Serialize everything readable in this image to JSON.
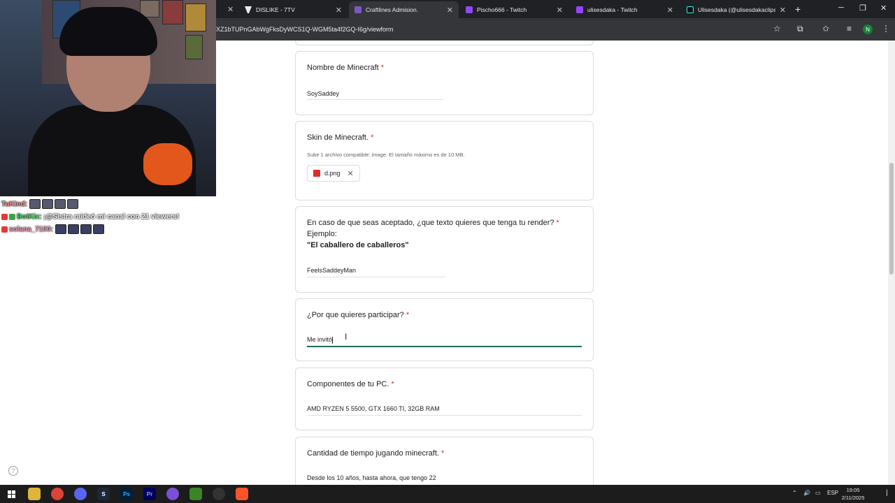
{
  "browser": {
    "tabs": [
      {
        "title": "DISLIKE - 7TV",
        "active": false
      },
      {
        "title": "Craftlines Admision.",
        "active": true
      },
      {
        "title": "Pischo666 - Twitch",
        "active": false
      },
      {
        "title": "ulisesdaka - Twitch",
        "active": false
      },
      {
        "title": "Ulisesdaka (@ulisesdakaclips) |",
        "active": false
      }
    ],
    "new_tab": "+",
    "url": "XZ1bTUPnGAbWgFksDyWCS1Q-WGM5ta4f2GQ-I6g/viewform",
    "profile_initial": "N"
  },
  "form": {
    "q1": {
      "title": "Nombre de Minecraft",
      "required": "*",
      "answer": "SoySaddey"
    },
    "q2": {
      "title": "Skin de Minecraft.",
      "required": "*",
      "hint": "Sube 1 archivo compatible: image. El tamaño máximo es de 10 MB.",
      "file_name": "d.png",
      "remove": "✕"
    },
    "q3": {
      "title": "En caso de que seas aceptado, ¿que texto quieres que tenga tu render?",
      "required": "*",
      "example_label": "Ejemplo:",
      "example_text": "\"El caballero de caballeros\"",
      "answer": "FeelsSaddeyMan"
    },
    "q4": {
      "title": "¿Por que quieres participar?",
      "required": "*",
      "answer": "Me invitó"
    },
    "q5": {
      "title": "Componentes de tu PC.",
      "required": "*",
      "answer": "AMD RYZEN 5 5500, GTX 1660 TI, 32GB RAM"
    },
    "q6": {
      "title": "Cantidad de tiempo jugando minecraft.",
      "required": "*",
      "answer": "Desde los 10 años, hasta ahora, que tengo 22"
    }
  },
  "chat": [
    {
      "user": "TuKind:",
      "message": ""
    },
    {
      "user": "BotKix:",
      "message": "¡@Sistra raideó mi canal con 21 viewers!"
    },
    {
      "user": "solana_7190:",
      "message": ""
    }
  ],
  "taskbar": {
    "language": "ESP",
    "time": "19:05",
    "date": "2/11/2025"
  },
  "help_icon": "?"
}
